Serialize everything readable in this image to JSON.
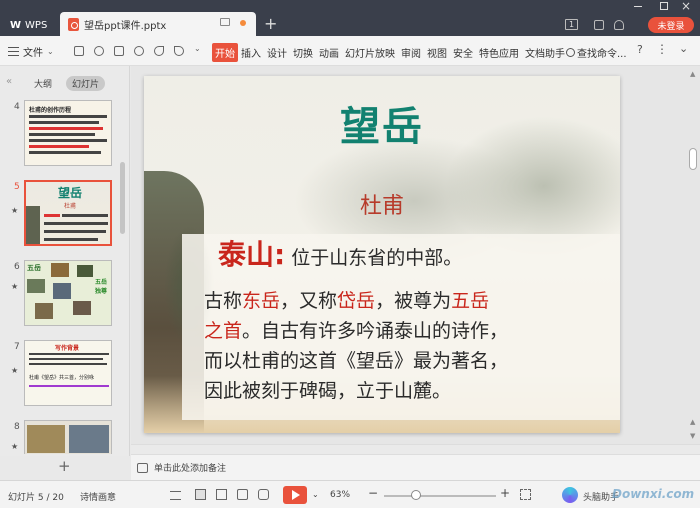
{
  "titlebar": {
    "app_label": "WPS",
    "doc_title": "望岳ppt课件.pptx",
    "new_tab": "+",
    "window_badge": "1",
    "login_label": "未登录"
  },
  "menubar": {
    "file_label": "文件",
    "tabs": [
      "开始",
      "插入",
      "设计",
      "切换",
      "动画",
      "幻灯片放映",
      "审阅",
      "视图",
      "安全",
      "特色应用",
      "文档助手"
    ],
    "search_label": "查找命令...",
    "help": "?",
    "more": "⋮",
    "collapse": "⌄"
  },
  "leftpanel": {
    "collapse": "«",
    "outline_tab": "大纲",
    "slides_tab": "幻灯片",
    "thumbnails": [
      {
        "num": "4",
        "title": "杜甫的创作历程"
      },
      {
        "num": "5",
        "title": "望岳",
        "sub": "杜甫",
        "star": "★"
      },
      {
        "num": "6",
        "title": "五岳",
        "side": "五岳独尊",
        "star": "★"
      },
      {
        "num": "7",
        "title": "写作背景",
        "line": "杜甫《望岳》共三首，分别咏",
        "star": "★"
      },
      {
        "num": "8",
        "star": "★"
      }
    ],
    "add_slide": "+"
  },
  "slide": {
    "title": "望岳",
    "author": "杜甫",
    "heading": "泰山:",
    "line1": "位于山东省的中部。",
    "line2_a": "古称",
    "line2_b": "东岳",
    "line2_c": "，又称",
    "line2_d": "岱岳",
    "line2_e": "，被尊为",
    "line2_f": "五岳",
    "line3_a": "之首",
    "line3_b": "。自古有许多吟诵泰山的诗作，",
    "line4": "而以杜甫的这首《望岳》最为著名，",
    "line5": "因此被刻于碑碣，立于山麓。"
  },
  "notes": {
    "placeholder": "单击此处添加备注"
  },
  "statusbar": {
    "slide_counter": "幻灯片 5 / 20",
    "theme": "诗情画意",
    "zoom": "63%",
    "zoom_minus": "−",
    "zoom_plus": "+",
    "assistant": "头脑助手"
  },
  "watermark": "Downxi.com",
  "colors": {
    "accent": "#e9523c",
    "title_teal": "#128170",
    "text_red": "#c9261c",
    "titlebar_bg": "#3a3f4b"
  }
}
